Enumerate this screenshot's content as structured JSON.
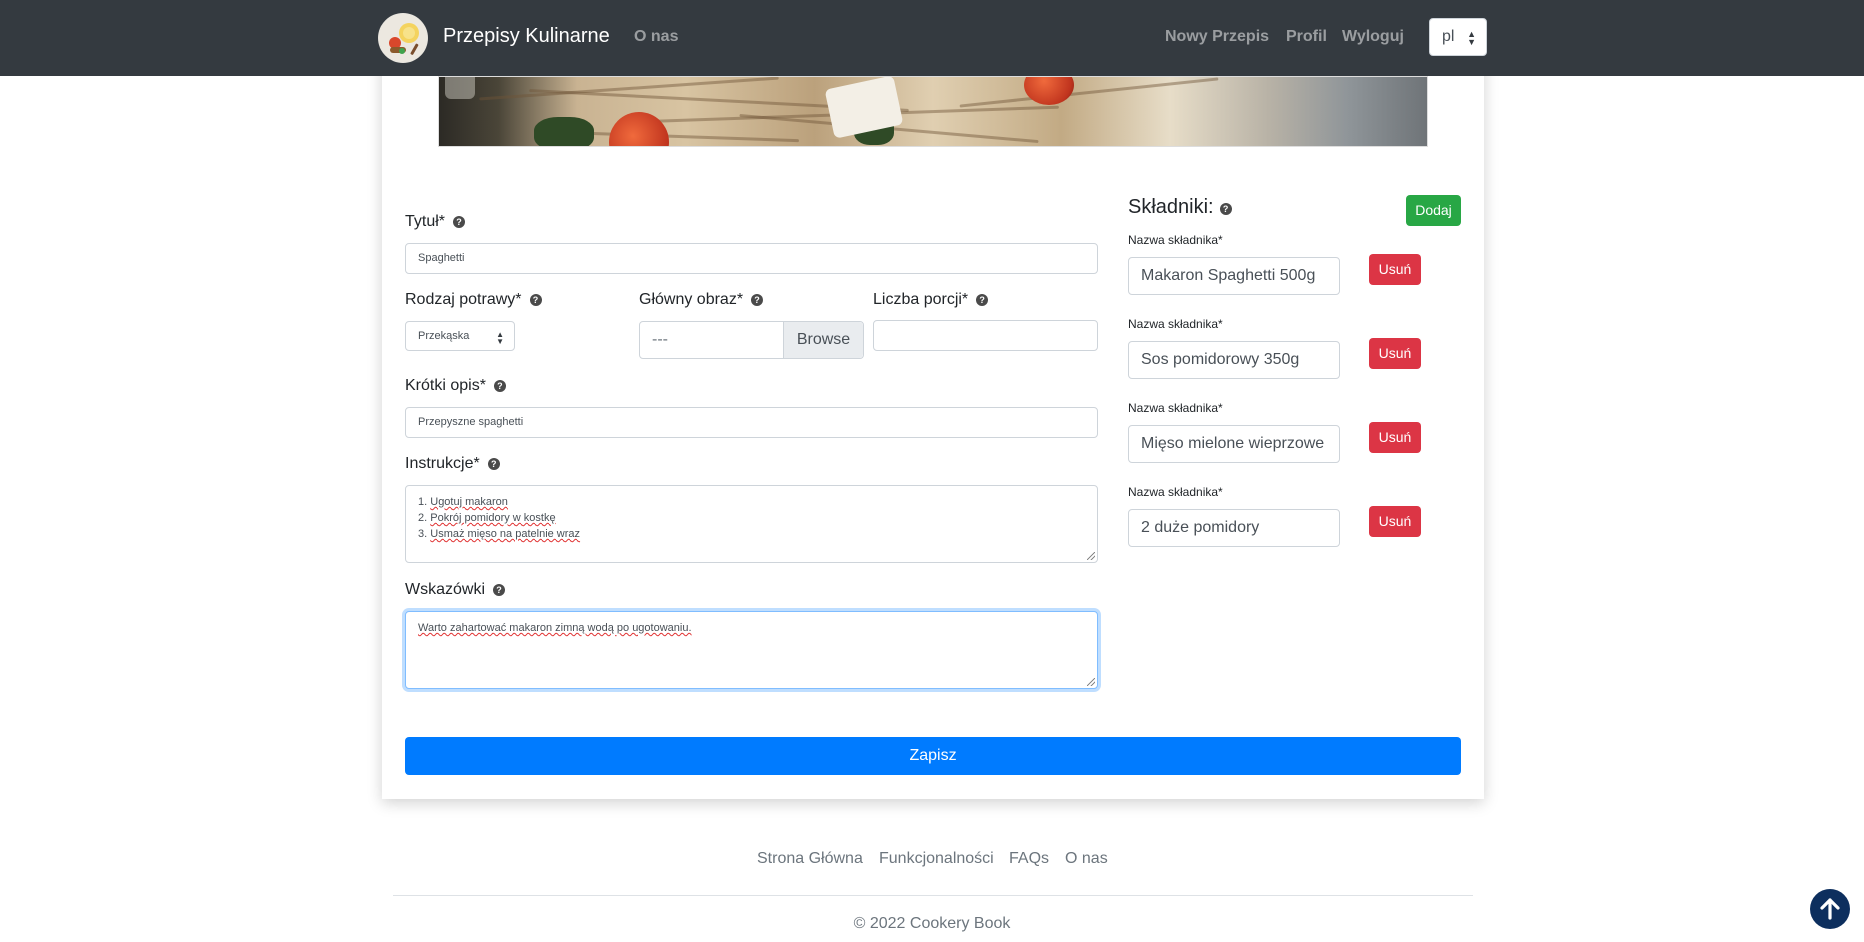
{
  "navbar": {
    "brand": "Przepisy Kulinarne",
    "about": "O nas",
    "new_recipe": "Nowy Przepis",
    "profile": "Profil",
    "logout": "Wyloguj",
    "language": "pl"
  },
  "form": {
    "title": {
      "label": "Tytuł*",
      "value": "Spaghetti"
    },
    "dish_type": {
      "label": "Rodzaj potrawy*",
      "value": "Przekąska"
    },
    "main_image": {
      "label": "Główny obraz*",
      "value": "---",
      "browse": "Browse"
    },
    "servings": {
      "label": "Liczba porcji*",
      "value": ""
    },
    "short_description": {
      "label": "Krótki opis*",
      "value": "Przepyszne spaghetti"
    },
    "instructions": {
      "label": "Instrukcje*",
      "lines": [
        {
          "num": "1.",
          "text": "Ugotuj makaron"
        },
        {
          "num": "2.",
          "text": "Pokrój pomidory w kostkę"
        },
        {
          "num": "3.",
          "text": "Usmaż mięso na patelnie wraz"
        }
      ]
    },
    "tips": {
      "label": "Wskazówki",
      "value": "Warto zahartować makaron zimną wodą po ugotowaniu."
    },
    "save_label": "Zapisz"
  },
  "ingredients": {
    "title": "Składniki:",
    "add_label": "Dodaj",
    "items": [
      {
        "label": "Nazwa składnika*",
        "value": "Makaron Spaghetti 500g",
        "remove": "Usuń"
      },
      {
        "label": "Nazwa składnika*",
        "value": "Sos pomidorowy 350g",
        "remove": "Usuń"
      },
      {
        "label": "Nazwa składnika*",
        "value": "Mięso mielone wieprzowe",
        "remove": "Usuń"
      },
      {
        "label": "Nazwa składnika*",
        "value": "2 duże pomidory",
        "remove": "Usuń"
      }
    ]
  },
  "footer": {
    "links": [
      "Strona Główna",
      "Funkcjonalności",
      "FAQs",
      "O nas"
    ],
    "copyright": "© 2022 Cookery Book"
  },
  "colors": {
    "navbar_bg": "#343a40",
    "primary": "#007bff",
    "success": "#28a745",
    "danger": "#dc3545"
  },
  "icons": {
    "help": "question-circle-icon",
    "scroll_top": "arrow-up-icon"
  }
}
